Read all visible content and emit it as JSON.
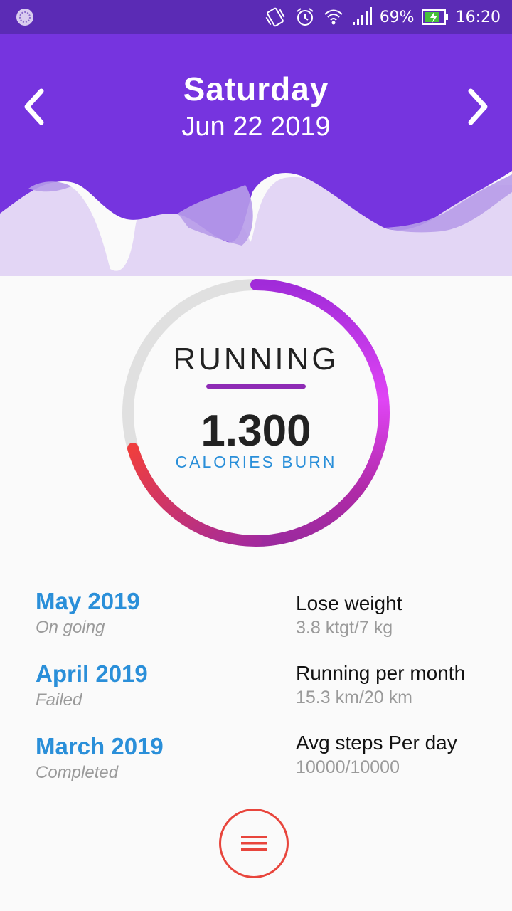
{
  "status_bar": {
    "battery": "69%",
    "time": "16:20"
  },
  "header": {
    "day": "Saturday",
    "date": "Jun 22 2019"
  },
  "activity": {
    "name": "RUNNING",
    "value": "1.300",
    "unit": "CALORIES BURN"
  },
  "months": [
    {
      "name": "May 2019",
      "status": "On going"
    },
    {
      "name": "April 2019",
      "status": "Failed"
    },
    {
      "name": "March 2019",
      "status": "Completed"
    }
  ],
  "goals": [
    {
      "name": "Lose weight",
      "value": "3.8 ktgt/7 kg"
    },
    {
      "name": "Running per month",
      "value": "15.3 km/20 km"
    },
    {
      "name": "Avg steps Per day",
      "value": "10000/10000"
    }
  ],
  "colors": {
    "header": "#7634df",
    "status_bar": "#5b2bb5",
    "accent_blue": "#2a8fd9",
    "menu_red": "#e8453c"
  },
  "icons": {
    "prev": "chevron-left-icon",
    "next": "chevron-right-icon",
    "menu": "hamburger-menu-icon"
  }
}
